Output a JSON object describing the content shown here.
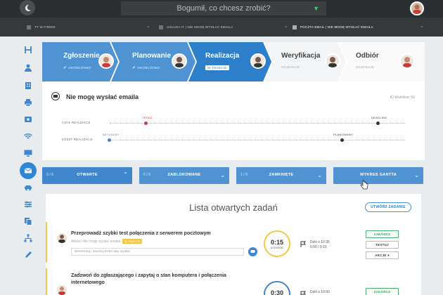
{
  "topbar": {
    "search_placeholder": "Bogumił, co chcesz zrobić?"
  },
  "breadcrumbs": [
    {
      "label": "TY W FIRMIE"
    },
    {
      "label": "USŁUGA IT | NIE MOGĘ WYSŁAĆ EMAILA"
    },
    {
      "label": "POCZTA EMAIL | NIE MOGĘ WYSŁAĆ EMAILA"
    }
  ],
  "sidebar": {
    "items": [
      "workflow-icon",
      "people-icon",
      "building-icon",
      "printer-icon",
      "phone-icon",
      "wifi-icon",
      "monitor-icon",
      "mail-icon",
      "car-icon",
      "settings-icon",
      "copy-icon",
      "tree-icon",
      "pen-icon"
    ],
    "active": "mail-icon",
    "accent": "#2e86d6"
  },
  "workflow": {
    "steps": [
      {
        "title": "Zgłoszenie",
        "status": "UKOŃCZONO"
      },
      {
        "title": "Planowanie",
        "status": "UKOŃCZONO"
      },
      {
        "title": "Realizacja",
        "status": "W TRAKCIE"
      },
      {
        "title": "Weryfikacja",
        "status": "OCZEKUJE"
      },
      {
        "title": "Odbiór",
        "status": "OCZEKUJE"
      }
    ],
    "task_title": "Nie mogę wysłać emaila",
    "workflow_id": "ID Workflow: 56",
    "timeline": {
      "time_label": "CZAS REALIZACJI",
      "cost_label": "KOSZT REALIZACJI",
      "now_label": "TERAZ",
      "deadline_label": "DEADLINE",
      "actual_label": "AKTUALNY",
      "planned_label": "PLANOWANY"
    }
  },
  "tabs": [
    {
      "count": "3 / 9",
      "label": "OTWARTE"
    },
    {
      "count": "5 / 9",
      "label": "ZABLOKOWANE"
    },
    {
      "count": "1 / 9",
      "label": "ZAMKNIĘTE"
    },
    {
      "count": "",
      "label": "WYKRES GANTTA"
    }
  ],
  "list": {
    "title": "Lista otwartych zadań",
    "new_task_label": "UTWÓRZ ZADANIE",
    "rows": [
      {
        "title": "Przeprowadź szybki test połączenia z serwerem pocztowym",
        "subtitle": "Aktość Nie mogę wysłać emaila",
        "pill": "W TRAKCIE",
        "comment_placeholder": "skomentuj i naciśnij Enter aby wysłać",
        "timer": "0:15",
        "timer_label": "pozostało",
        "time_line1": "Dziś o 10:35",
        "time_line2": "0:00 / 0:15",
        "actions": [
          "ZAKOŃCZ",
          "TESTUJ",
          "AKCJE"
        ]
      },
      {
        "title": "Zadzwoń do zgłaszającego i zapytaj o stan komputera i połączenia internetowego",
        "timer": "0:30",
        "time_line1": "Dziś o 10:50",
        "actions": [
          "ZAKOŃCZ"
        ]
      }
    ]
  }
}
